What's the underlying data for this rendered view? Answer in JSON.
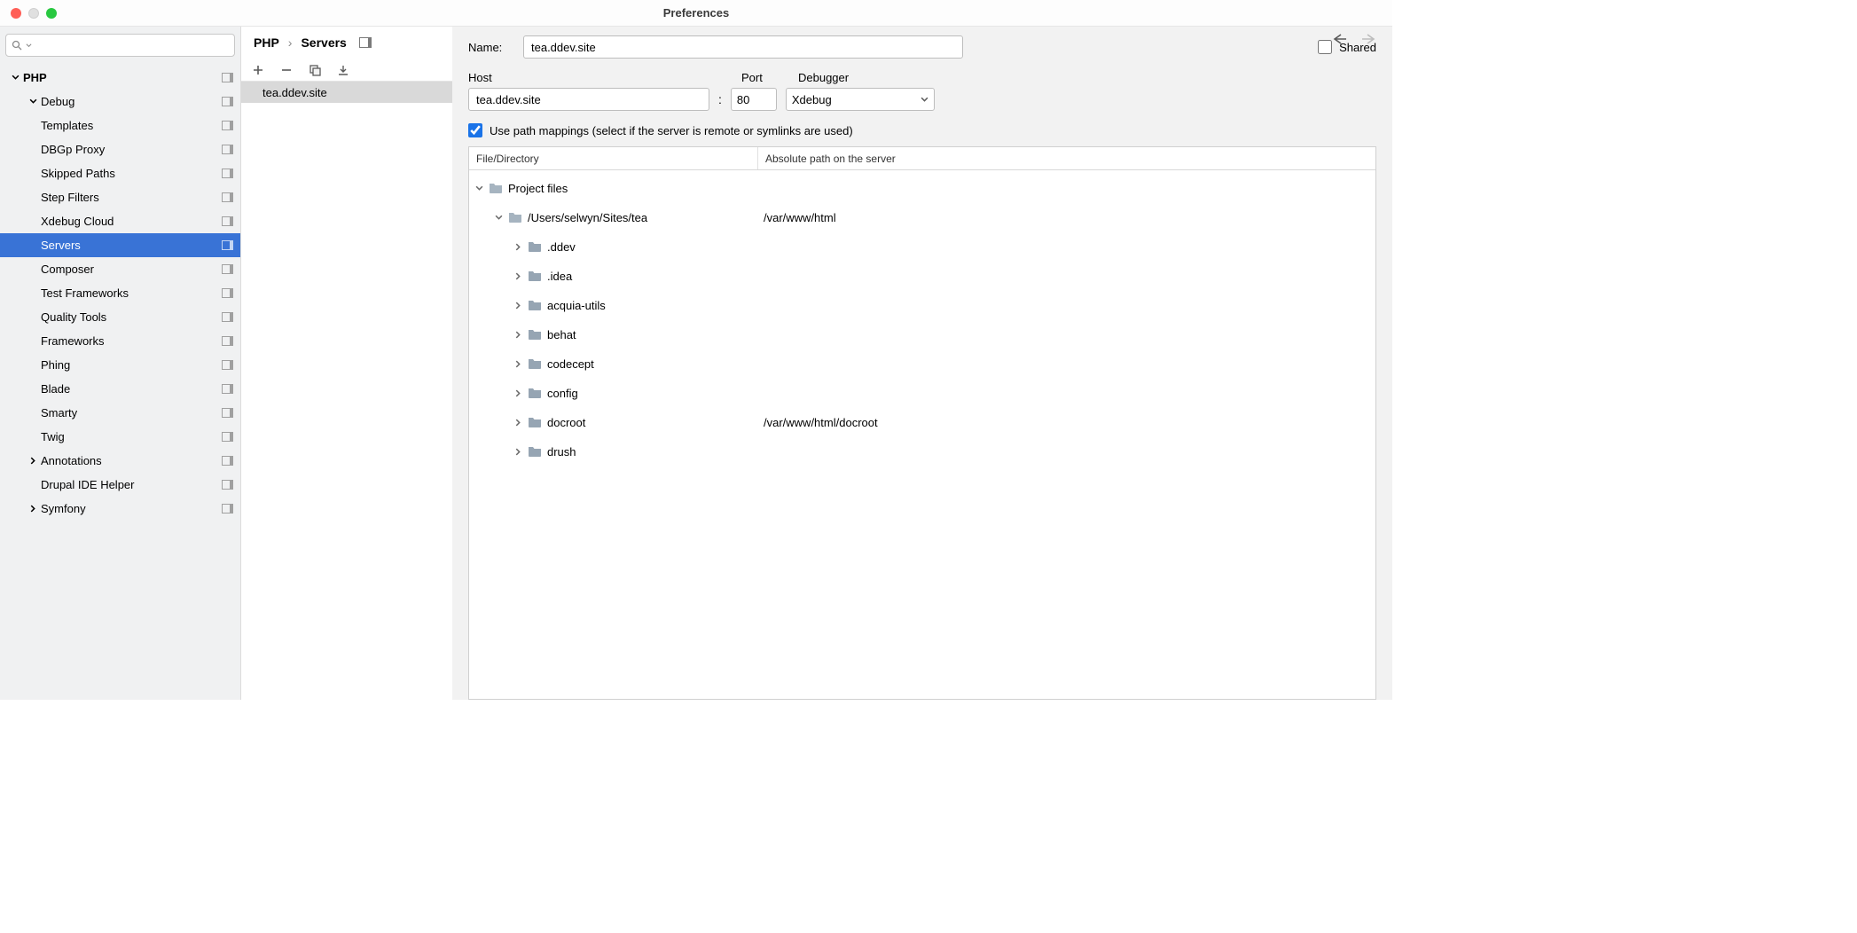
{
  "window": {
    "title": "Preferences"
  },
  "breadcrumb": {
    "root": "PHP",
    "sep": "›",
    "leaf": "Servers"
  },
  "nav_arrows": {
    "back": "←",
    "forward": "→"
  },
  "sidebar": {
    "items": [
      {
        "label": "PHP",
        "level": 0,
        "expanded": true,
        "badge": true
      },
      {
        "label": "Debug",
        "level": 1,
        "expanded": true,
        "badge": true,
        "arrow": true
      },
      {
        "label": "Templates",
        "level": 2,
        "badge": true
      },
      {
        "label": "DBGp Proxy",
        "level": 2,
        "badge": true
      },
      {
        "label": "Skipped Paths",
        "level": 2,
        "badge": true
      },
      {
        "label": "Step Filters",
        "level": 2,
        "badge": true
      },
      {
        "label": "Xdebug Cloud",
        "level": 2,
        "badge": true
      },
      {
        "label": "Servers",
        "level": 1,
        "badge": true,
        "selected": true,
        "noarrow": true
      },
      {
        "label": "Composer",
        "level": 1,
        "badge": true,
        "noarrow": true
      },
      {
        "label": "Test Frameworks",
        "level": 1,
        "badge": true,
        "noarrow": true
      },
      {
        "label": "Quality Tools",
        "level": 1,
        "badge": true,
        "noarrow": true
      },
      {
        "label": "Frameworks",
        "level": 1,
        "badge": true,
        "noarrow": true
      },
      {
        "label": "Phing",
        "level": 1,
        "badge": true,
        "noarrow": true
      },
      {
        "label": "Blade",
        "level": 1,
        "badge": true,
        "noarrow": true
      },
      {
        "label": "Smarty",
        "level": 1,
        "badge": true,
        "noarrow": true
      },
      {
        "label": "Twig",
        "level": 1,
        "badge": true,
        "noarrow": true
      },
      {
        "label": "Annotations",
        "level": 1,
        "badge": true,
        "arrow": true,
        "collapsed": true
      },
      {
        "label": "Drupal IDE Helper",
        "level": 1,
        "badge": true,
        "noarrow": true
      },
      {
        "label": "Symfony",
        "level": 1,
        "badge": true,
        "arrow": true,
        "collapsed": true
      }
    ]
  },
  "server_list": {
    "items": [
      {
        "name": "tea.ddev.site"
      }
    ]
  },
  "form": {
    "name_label": "Name:",
    "name_value": "tea.ddev.site",
    "shared_label": "Shared",
    "host_label": "Host",
    "host_value": "tea.ddev.site",
    "colon": ":",
    "port_label": "Port",
    "port_value": "80",
    "debugger_label": "Debugger",
    "debugger_value": "Xdebug",
    "path_mappings_label": "Use path mappings (select if the server is remote or symlinks are used)",
    "path_mappings_checked": true
  },
  "mappings": {
    "col1": "File/Directory",
    "col2": "Absolute path on the server",
    "rows": [
      {
        "indent": 0,
        "expanded": true,
        "name": "Project files",
        "abs": "",
        "folder_color": "#a6b4c0"
      },
      {
        "indent": 1,
        "expanded": true,
        "name": "/Users/selwyn/Sites/tea",
        "abs": "/var/www/html",
        "folder_color": "#a6b4c0"
      },
      {
        "indent": 2,
        "collapsed": true,
        "name": ".ddev",
        "abs": "",
        "folder_color": "#96a5b3"
      },
      {
        "indent": 2,
        "collapsed": true,
        "name": ".idea",
        "abs": "",
        "folder_color": "#96a5b3"
      },
      {
        "indent": 2,
        "collapsed": true,
        "name": "acquia-utils",
        "abs": "",
        "folder_color": "#96a5b3"
      },
      {
        "indent": 2,
        "collapsed": true,
        "name": "behat",
        "abs": "",
        "folder_color": "#96a5b3"
      },
      {
        "indent": 2,
        "collapsed": true,
        "name": "codecept",
        "abs": "",
        "folder_color": "#96a5b3"
      },
      {
        "indent": 2,
        "collapsed": true,
        "name": "config",
        "abs": "",
        "folder_color": "#96a5b3"
      },
      {
        "indent": 2,
        "collapsed": true,
        "name": "docroot",
        "abs": "/var/www/html/docroot",
        "folder_color": "#96a5b3"
      },
      {
        "indent": 2,
        "collapsed": true,
        "name": "drush",
        "abs": "",
        "folder_color": "#96a5b3"
      }
    ]
  }
}
